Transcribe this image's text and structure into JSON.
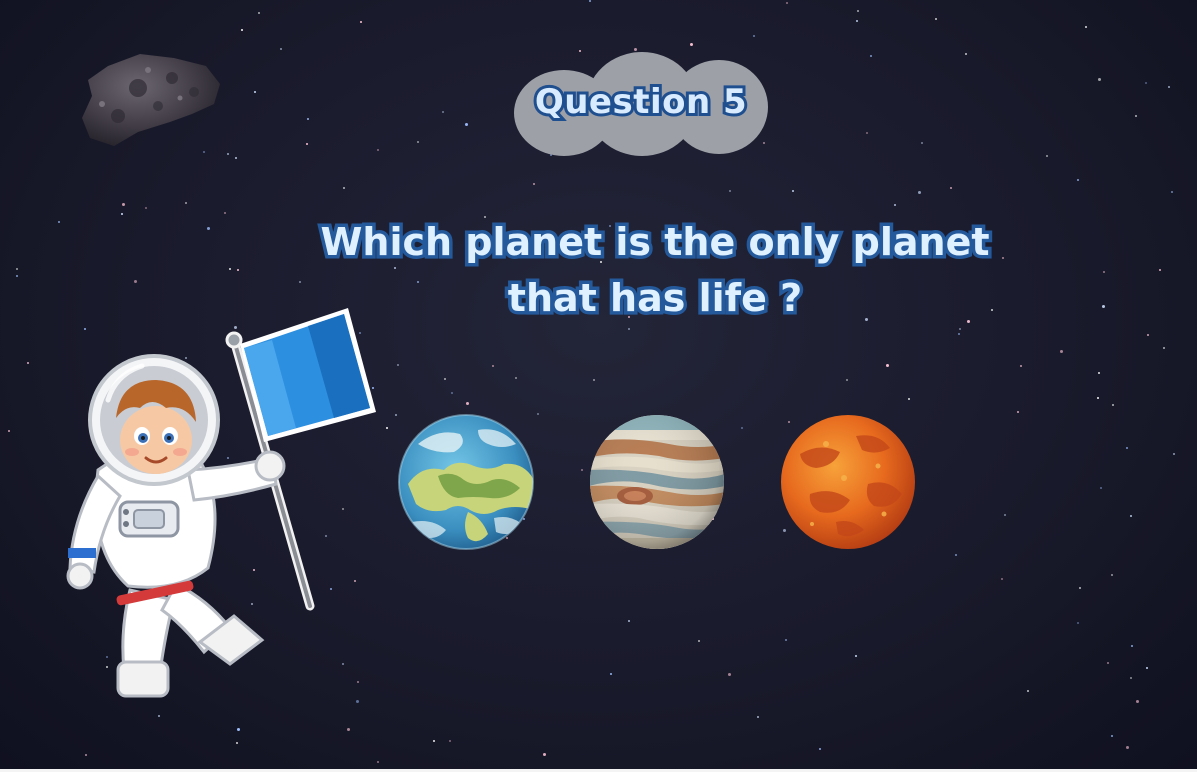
{
  "game": {
    "question_number_label": "Question 5",
    "question_line1": "Which planet is the only planet",
    "question_line2": "that has life ?"
  },
  "answers": [
    {
      "icon": "earth-planet-icon"
    },
    {
      "icon": "jupiter-planet-icon"
    },
    {
      "icon": "mars-planet-icon"
    }
  ],
  "decorations": {
    "asteroid": "asteroid-icon",
    "astronaut": "astronaut-with-blue-flag-icon"
  },
  "colors": {
    "background": "#1b1c2e",
    "text_fill": "#dff0ff",
    "text_outline": "#245a9c",
    "badge": "#9ea0a8",
    "flag": "#2d8fe0"
  }
}
